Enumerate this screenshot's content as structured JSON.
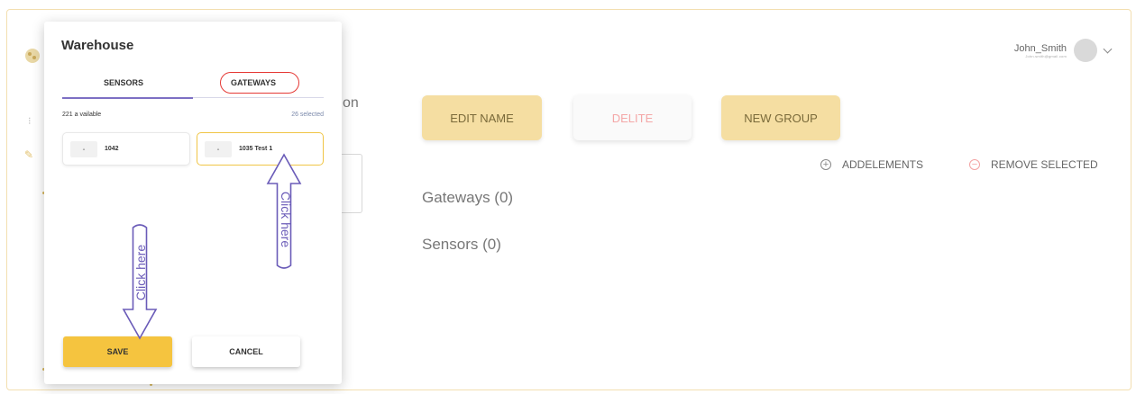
{
  "header": {
    "user_name": "John_Smith",
    "user_email": "John.smith@gmail.com"
  },
  "background": {
    "partial_text": "on",
    "buttons": {
      "edit_name": "EDIT NAME",
      "delete": "DELITE",
      "new_group": "NEW GROUP"
    },
    "actions": {
      "add_elements": "ADDELEMENTS",
      "remove_selected": "REMOVE SELECTED"
    },
    "sections": {
      "gateways": "Gateways (0)",
      "sensors": "Sensors (0)"
    }
  },
  "modal": {
    "title": "Warehouse",
    "tabs": [
      {
        "label": "SENSORS",
        "active": true
      },
      {
        "label": "GATEWAYS",
        "active": false
      }
    ],
    "available_text": "221 a vailable",
    "selected_text": "26 selected",
    "items": [
      {
        "label": "1042",
        "selected": false
      },
      {
        "label": "1035 Test 1",
        "selected": true
      }
    ],
    "save_label": "SAVE",
    "cancel_label": "CANCEL"
  },
  "annotations": {
    "click_here_1": "Click here",
    "click_here_2": "Click here"
  },
  "colors": {
    "accent_yellow": "#f5c43f",
    "tab_active": "#7d6fc4",
    "annotation": "#6a5bb8",
    "highlight_red": "#e53935"
  }
}
